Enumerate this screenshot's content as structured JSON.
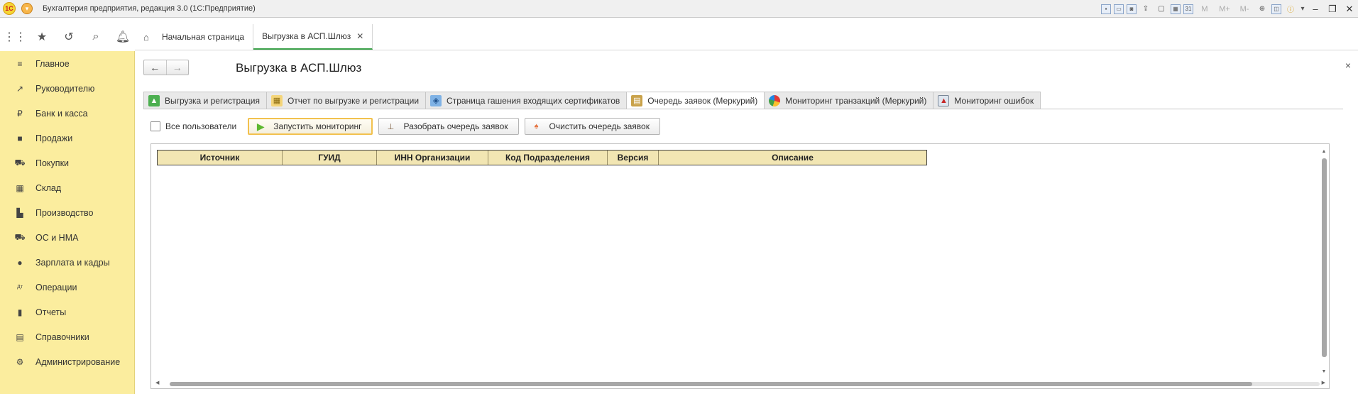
{
  "window": {
    "logo": "1С",
    "title": "Бухгалтерия предприятия, редакция 3.0  (1С:Предприятие)",
    "memory_buttons": [
      "M",
      "M+",
      "M-"
    ],
    "controls": [
      "–",
      "❐",
      "✕"
    ]
  },
  "page_tabs": [
    {
      "label": "Начальная страница",
      "active": false,
      "icon": "home-icon"
    },
    {
      "label": "Выгрузка в АСП.Шлюз",
      "active": true,
      "closable": true
    }
  ],
  "sidebar": {
    "items": [
      {
        "label": "Главное",
        "icon": "menu-lines-icon",
        "glyph": "≡"
      },
      {
        "label": "Руководителю",
        "icon": "trend-icon",
        "glyph": "↗"
      },
      {
        "label": "Банк и касса",
        "icon": "ruble-coin-icon",
        "glyph": "₽"
      },
      {
        "label": "Продажи",
        "icon": "bag-icon",
        "glyph": "■"
      },
      {
        "label": "Покупки",
        "icon": "cart-icon",
        "glyph": "⛟"
      },
      {
        "label": "Склад",
        "icon": "warehouse-icon",
        "glyph": "▦"
      },
      {
        "label": "Производство",
        "icon": "factory-icon",
        "glyph": "▙"
      },
      {
        "label": "ОС и НМА",
        "icon": "truck-icon",
        "glyph": "⛟"
      },
      {
        "label": "Зарплата и кадры",
        "icon": "person-icon",
        "glyph": "●"
      },
      {
        "label": "Операции",
        "icon": "debit-credit-icon",
        "glyph": "Дт"
      },
      {
        "label": "Отчеты",
        "icon": "bar-chart-icon",
        "glyph": "▮"
      },
      {
        "label": "Справочники",
        "icon": "book-icon",
        "glyph": "▤"
      },
      {
        "label": "Администрирование",
        "icon": "gear-icon",
        "glyph": "⚙"
      }
    ]
  },
  "form": {
    "title": "Выгрузка в АСП.Шлюз",
    "close": "×",
    "tabs": [
      {
        "label": "Выгрузка и регистрация",
        "icon": "upload-green-icon",
        "active": false
      },
      {
        "label": "Отчет по выгрузке и регистрации",
        "icon": "report-grid-icon",
        "active": false
      },
      {
        "label": "Страница гашения входящих сертификатов",
        "icon": "certificate-icon",
        "active": false
      },
      {
        "label": "Очередь заявок (Меркурий)",
        "icon": "queue-book-icon",
        "active": true
      },
      {
        "label": "Мониторинг транзакций (Меркурий)",
        "icon": "pie-chart-icon",
        "active": false
      },
      {
        "label": "Мониторинг ошибок",
        "icon": "monitor-error-icon",
        "active": false
      }
    ],
    "checkbox_label": "Все пользователи",
    "checkbox_checked": false,
    "buttons": {
      "start": "Запустить мониторинг",
      "parse": "Разобрать очередь заявок",
      "clear": "Очистить очередь заявок"
    },
    "table": {
      "columns": [
        "Источник",
        "ГУИД",
        "ИНН Организации",
        "Код Подразделения",
        "Версия",
        "Описание"
      ],
      "rows": []
    }
  },
  "colors": {
    "sidebar_bg": "#fbed9e",
    "active_tab_underline": "#3ca34b",
    "table_header_bg": "#f2e6b3",
    "default_button_border": "#f2c14e"
  }
}
